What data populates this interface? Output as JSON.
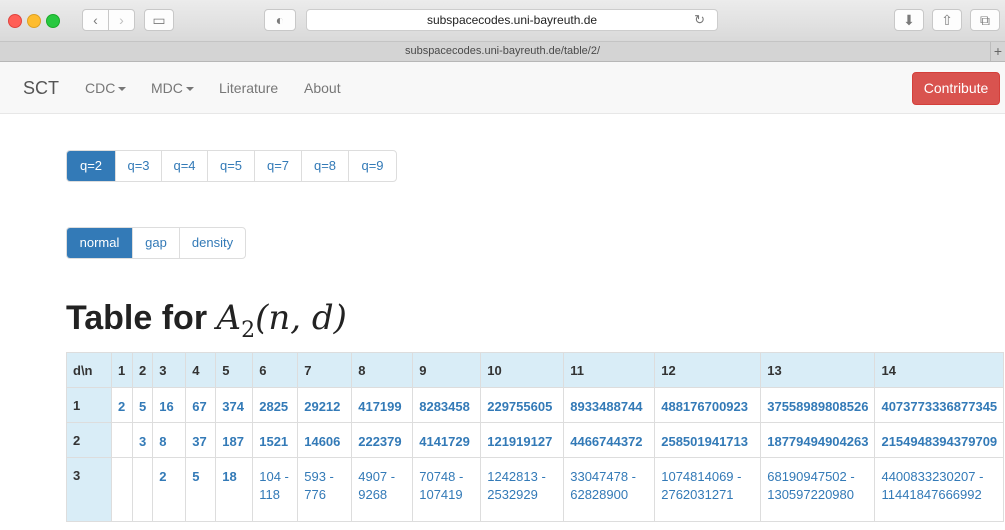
{
  "browser": {
    "url": "subspacecodes.uni-bayreuth.de",
    "tab_title": "subspacecodes.uni-bayreuth.de/table/2/",
    "back_icon": "‹",
    "forward_icon": "›",
    "sidebar_icon": "▭",
    "privacy_icon": "◐",
    "reload_icon": "↻",
    "download_icon": "⬇",
    "share_icon": "⇧",
    "tabs_icon": "⧉",
    "new_tab": "+"
  },
  "navbar": {
    "brand": "SCT",
    "items": [
      "CDC",
      "MDC",
      "Literature",
      "About"
    ],
    "contribute": "Contribute"
  },
  "q_buttons": {
    "items": [
      "q=2",
      "q=3",
      "q=4",
      "q=5",
      "q=7",
      "q=8",
      "q=9"
    ],
    "active": "q=2"
  },
  "mode_buttons": {
    "items": [
      "normal",
      "gap",
      "density"
    ],
    "active": "normal"
  },
  "title": {
    "prefix": "Table for",
    "symbol": "A",
    "subscript": "2",
    "args": "(n, d)"
  },
  "table": {
    "corner": "d\\n",
    "columns": [
      "1",
      "2",
      "3",
      "4",
      "5",
      "6",
      "7",
      "8",
      "9",
      "10",
      "11",
      "12",
      "13",
      "14"
    ],
    "rows": [
      {
        "label": "1",
        "cells": [
          "2",
          "5",
          "16",
          "67",
          "374",
          "2825",
          "29212",
          "417199",
          "8283458",
          "229755605",
          "8933488744",
          "488176700923",
          "37558989808526",
          "4073773336877345"
        ]
      },
      {
        "label": "2",
        "cells": [
          "",
          "3",
          "8",
          "37",
          "187",
          "1521",
          "14606",
          "222379",
          "4141729",
          "121919127",
          "4466744372",
          "258501941713",
          "18779494904263",
          "2154948394379709"
        ]
      },
      {
        "label": "3",
        "cells": [
          "",
          "",
          "2",
          "5",
          "18",
          "104 - 118",
          "593 - 776",
          "4907 - 9268",
          "70748 - 107419",
          "1242813 - 2532929",
          "33047478 - 62828900",
          "1074814069 - 2762031271",
          "68190947502 - 130597220980",
          "4400833230207 - 11441847666992"
        ]
      }
    ]
  },
  "colors": {
    "primary": "#337ab7",
    "danger": "#d9534f",
    "table_header": "#d9edf7"
  }
}
